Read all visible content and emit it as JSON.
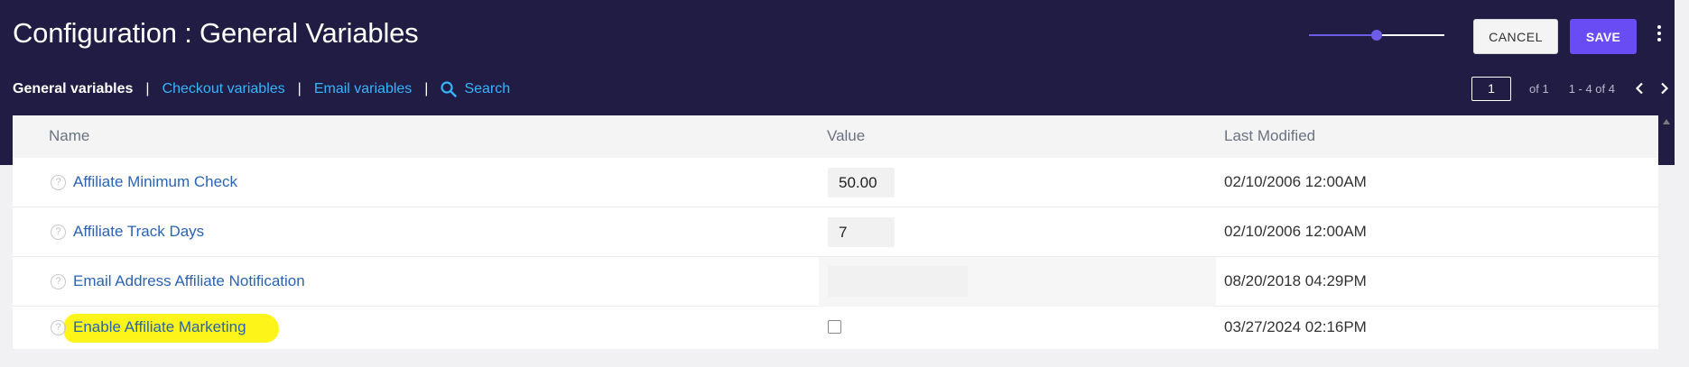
{
  "header": {
    "title": "Configuration : General Variables",
    "zoom_slider_value": 0.5,
    "cancel_label": "CANCEL",
    "save_label": "SAVE"
  },
  "subnav": {
    "items": [
      {
        "label": "General variables",
        "active": true
      },
      {
        "label": "Checkout variables",
        "active": false
      },
      {
        "label": "Email variables",
        "active": false
      }
    ],
    "separator": "|",
    "search_label": "Search"
  },
  "pagination": {
    "current_page": "1",
    "of_label": "of 1",
    "range_label": "1 - 4 of 4"
  },
  "table": {
    "columns": [
      "Name",
      "Value",
      "Last Modified"
    ],
    "rows": [
      {
        "name": "Affiliate Minimum Check",
        "value_type": "text",
        "value": "50.00",
        "last_modified": "02/10/2006 12:00AM"
      },
      {
        "name": "Affiliate Track Days",
        "value_type": "text",
        "value": "7",
        "last_modified": "02/10/2006 12:00AM"
      },
      {
        "name": "Email Address Affiliate Notification",
        "value_type": "empty",
        "value": "",
        "last_modified": "08/20/2018 04:29PM"
      },
      {
        "name": "Enable Affiliate Marketing",
        "value_type": "checkbox",
        "value": false,
        "last_modified": "03/27/2024 02:16PM",
        "highlighted": true
      }
    ]
  },
  "colors": {
    "header_bg": "#211c43",
    "accent": "#6a4cf5",
    "link": "#35b4ff",
    "name_link": "#2a63b4",
    "highlight": "#fdf41a"
  },
  "icons": {
    "help": "question-circle-icon",
    "search": "magnifier-icon",
    "more": "kebab-vertical-icon",
    "prev": "chevron-left-icon",
    "next": "chevron-right-icon"
  }
}
